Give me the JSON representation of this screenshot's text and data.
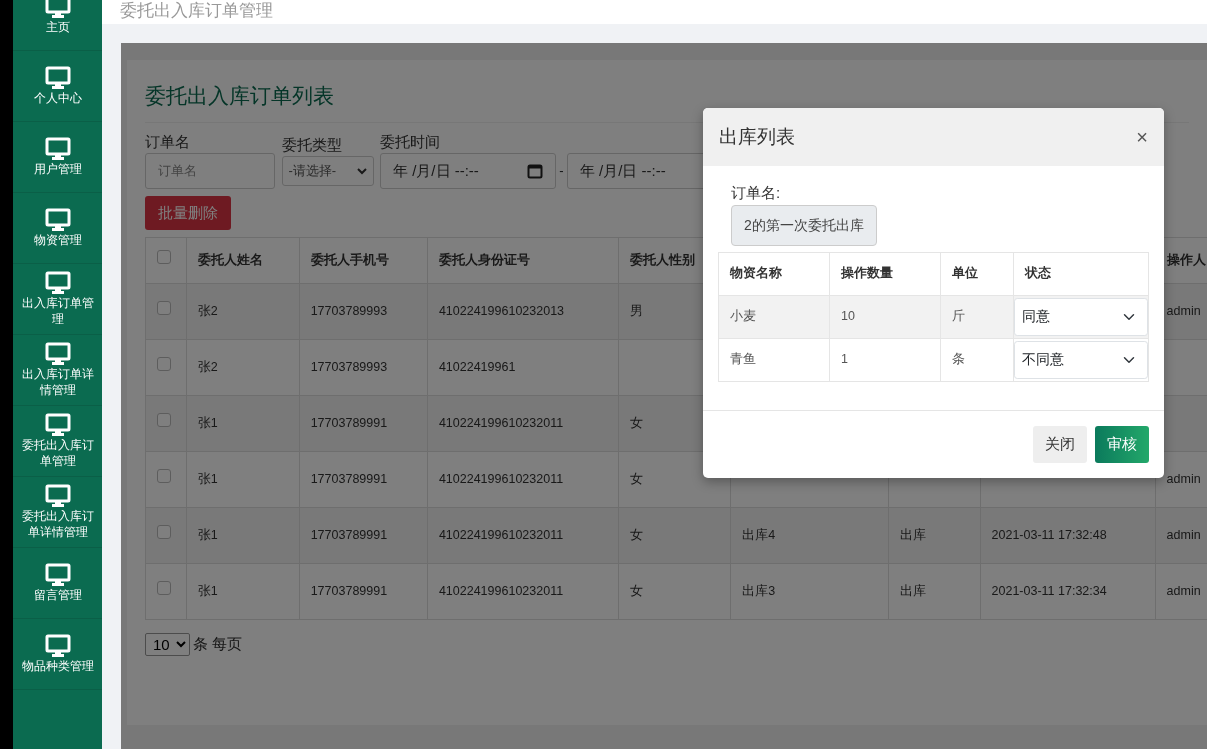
{
  "sidebar": {
    "items": [
      {
        "label": "主页"
      },
      {
        "label": "个人中心"
      },
      {
        "label": "用户管理"
      },
      {
        "label": "物资管理"
      },
      {
        "label": "出入库订单管理"
      },
      {
        "label": "出入库订单详情管理"
      },
      {
        "label": "委托出入库订单管理"
      },
      {
        "label": "委托出入库订单详情管理"
      },
      {
        "label": "留言管理"
      },
      {
        "label": "物品种类管理"
      }
    ]
  },
  "page_title": "委托出入库订单管理",
  "card_title": "委托出入库订单列表",
  "filters": {
    "order_name": {
      "label": "订单名",
      "placeholder": "订单名"
    },
    "type": {
      "label": "委托类型",
      "value": "-请选择-"
    },
    "time": {
      "label": "委托时间",
      "start": "年 /月/日 --:--",
      "separator": "-",
      "end": "年 /月/日 --:--"
    }
  },
  "batch_delete": "批量删除",
  "table": {
    "select_all_checked": false,
    "columns": [
      "委托人姓名",
      "委托人手机号",
      "委托人身份证号",
      "委托人性别",
      "",
      "",
      "",
      "操作人"
    ],
    "rows": [
      {
        "checked": false,
        "cells": [
          "张2",
          "17703789993",
          "410224199610232013",
          "男",
          "",
          "",
          "",
          "admin"
        ]
      },
      {
        "checked": false,
        "cells": [
          "张2",
          "17703789993",
          "41022419961",
          "",
          "",
          "",
          "",
          ""
        ]
      },
      {
        "checked": false,
        "cells": [
          "张1",
          "17703789991",
          "410224199610232011",
          "女",
          "",
          "",
          "",
          ""
        ]
      },
      {
        "checked": false,
        "cells": [
          "张1",
          "17703789991",
          "410224199610232011",
          "女",
          "",
          "",
          "",
          "admin"
        ]
      },
      {
        "checked": false,
        "cells": [
          "张1",
          "17703789991",
          "410224199610232011",
          "女",
          "出库4",
          "出库",
          "2021-03-11 17:32:48",
          "admin"
        ]
      },
      {
        "checked": false,
        "cells": [
          "张1",
          "17703789991",
          "410224199610232011",
          "女",
          "出库3",
          "出库",
          "2021-03-11 17:32:34",
          "admin"
        ]
      }
    ]
  },
  "pagination": {
    "page_size": "10",
    "suffix": "条 每页"
  },
  "modal": {
    "title": "出库列表",
    "close": "×",
    "order_label": "订单名:",
    "order_value": "2的第一次委托出库",
    "columns": [
      "物资名称",
      "操作数量",
      "单位",
      "状态"
    ],
    "rows": [
      {
        "highlighted": true,
        "cells": [
          "小麦",
          "10",
          "斤"
        ],
        "status": "同意"
      },
      {
        "highlighted": false,
        "cells": [
          "青鱼",
          "1",
          "条"
        ],
        "status": "不同意"
      }
    ],
    "buttons": [
      {
        "label": "关闭",
        "kind": "secondary"
      },
      {
        "label": "审核",
        "kind": "primary"
      }
    ]
  }
}
